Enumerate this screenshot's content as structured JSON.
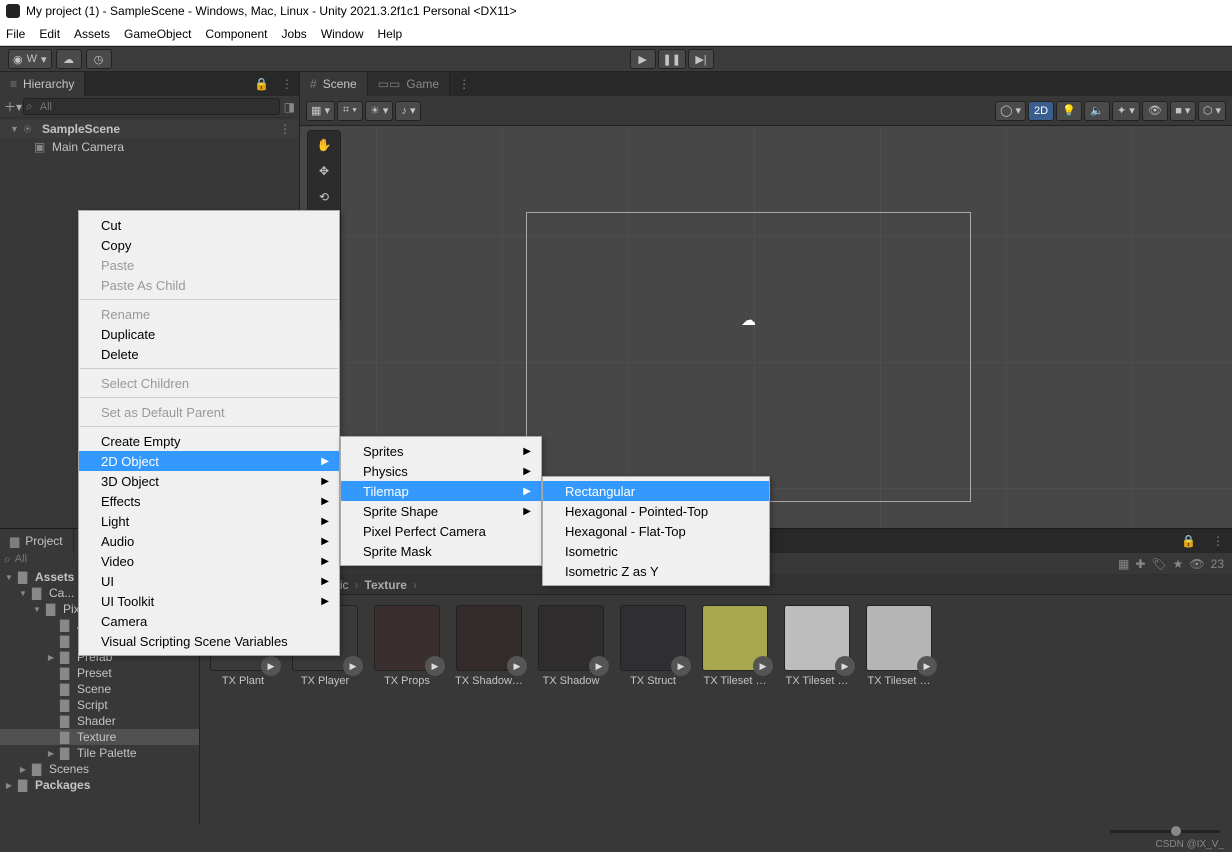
{
  "title": "My project (1) - SampleScene - Windows, Mac, Linux - Unity 2021.3.2f1c1 Personal <DX11>",
  "menubar": [
    "File",
    "Edit",
    "Assets",
    "GameObject",
    "Component",
    "Jobs",
    "Window",
    "Help"
  ],
  "toolbar": {
    "account_label": "W",
    "mode_2d": "2D"
  },
  "hierarchy": {
    "tab": "Hierarchy",
    "search_placeholder": "All",
    "root": "SampleScene",
    "children": [
      "Main Camera"
    ]
  },
  "scene": {
    "tab_scene": "Scene",
    "tab_game": "Game"
  },
  "project": {
    "tab": "Project",
    "search_placeholder": "All",
    "tree": [
      {
        "label": "Assets",
        "depth": 0,
        "arrow": "▼",
        "bold": true
      },
      {
        "label": "Ca...",
        "depth": 1,
        "arrow": "▼"
      },
      {
        "label": "Pixel Art Top Down - B...",
        "depth": 2,
        "arrow": "▼",
        "cut": true
      },
      {
        "label": "Animation",
        "depth": 3
      },
      {
        "label": "Material",
        "depth": 3
      },
      {
        "label": "Prefab",
        "depth": 3,
        "arrow": "▶"
      },
      {
        "label": "Preset",
        "depth": 3
      },
      {
        "label": "Scene",
        "depth": 3
      },
      {
        "label": "Script",
        "depth": 3
      },
      {
        "label": "Shader",
        "depth": 3
      },
      {
        "label": "Texture",
        "depth": 3,
        "sel": true
      },
      {
        "label": "Tile Palette",
        "depth": 3,
        "arrow": "▶"
      },
      {
        "label": "Scenes",
        "depth": 1,
        "arrow": "▶"
      },
      {
        "label": "Packages",
        "depth": 0,
        "arrow": "▶",
        "bold": true
      }
    ],
    "breadcrumb": [
      "Pixel Art Top Down - Basic",
      "Texture"
    ],
    "hidden_count": "23",
    "assets": [
      "TX Plant",
      "TX Player",
      "TX Props",
      "TX Shadow…",
      "TX Shadow",
      "TX Struct",
      "TX Tileset …",
      "TX Tileset …",
      "TX Tileset …"
    ],
    "asset_colors": [
      "#3a3a3a",
      "#3a3a3a",
      "#3a2e2e",
      "#332a2a",
      "#2e2c2c",
      "#2f2f33",
      "#a7a74d",
      "#bdbdbd",
      "#b5b5b5"
    ]
  },
  "context1": [
    {
      "t": "Cut"
    },
    {
      "t": "Copy"
    },
    {
      "t": "Paste",
      "dis": true
    },
    {
      "t": "Paste As Child",
      "dis": true
    },
    {
      "sep": true
    },
    {
      "t": "Rename",
      "dis": true
    },
    {
      "t": "Duplicate"
    },
    {
      "t": "Delete"
    },
    {
      "sep": true
    },
    {
      "t": "Select Children",
      "dis": true
    },
    {
      "sep": true
    },
    {
      "t": "Set as Default Parent",
      "dis": true
    },
    {
      "sep": true
    },
    {
      "t": "Create Empty"
    },
    {
      "t": "2D Object",
      "sub": true,
      "hi": true
    },
    {
      "t": "3D Object",
      "sub": true
    },
    {
      "t": "Effects",
      "sub": true
    },
    {
      "t": "Light",
      "sub": true
    },
    {
      "t": "Audio",
      "sub": true
    },
    {
      "t": "Video",
      "sub": true
    },
    {
      "t": "UI",
      "sub": true
    },
    {
      "t": "UI Toolkit",
      "sub": true
    },
    {
      "t": "Camera"
    },
    {
      "t": "Visual Scripting Scene Variables"
    }
  ],
  "context2": [
    {
      "t": "Sprites",
      "sub": true
    },
    {
      "t": "Physics",
      "sub": true
    },
    {
      "t": "Tilemap",
      "sub": true,
      "hi": true
    },
    {
      "t": "Sprite Shape",
      "sub": true
    },
    {
      "t": "Pixel Perfect Camera"
    },
    {
      "t": "Sprite Mask"
    }
  ],
  "context3": [
    {
      "t": "Rectangular",
      "hi": true
    },
    {
      "t": "Hexagonal - Pointed-Top"
    },
    {
      "t": "Hexagonal - Flat-Top"
    },
    {
      "t": "Isometric"
    },
    {
      "t": "Isometric Z as Y"
    }
  ],
  "watermark": "CSDN @IX_V_"
}
